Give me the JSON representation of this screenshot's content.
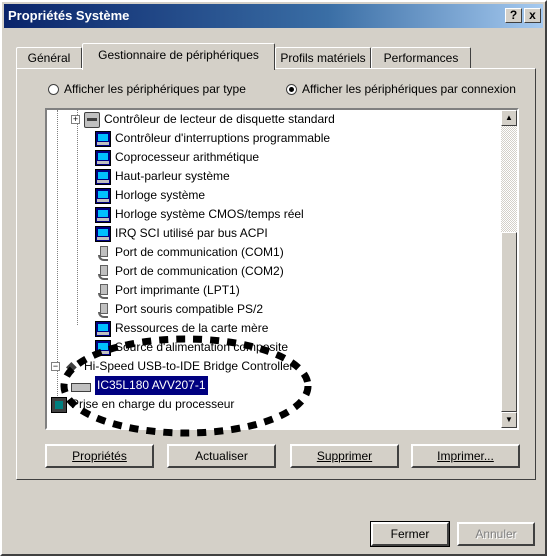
{
  "window": {
    "title": "Propriétés Système",
    "help_label": "?",
    "close_label": "x"
  },
  "tabs": [
    {
      "label": "Général"
    },
    {
      "label": "Gestionnaire de périphériques"
    },
    {
      "label": "Profils matériels"
    },
    {
      "label": "Performances"
    }
  ],
  "view": {
    "by_type_label": "Afficher les périphériques par type",
    "by_connection_label": "Afficher les périphériques par connexion",
    "selected": "by_connection"
  },
  "tree": {
    "items": [
      {
        "label": "Contrôleur de lecteur de disquette standard",
        "icon": "floppy-icon"
      },
      {
        "label": "Contrôleur d'interruptions programmable",
        "icon": "computer-icon"
      },
      {
        "label": "Coprocesseur arithmétique",
        "icon": "computer-icon"
      },
      {
        "label": "Haut-parleur système",
        "icon": "computer-icon"
      },
      {
        "label": "Horloge système",
        "icon": "computer-icon"
      },
      {
        "label": "Horloge système CMOS/temps réel",
        "icon": "computer-icon"
      },
      {
        "label": "IRQ SCI utilisé par bus ACPI",
        "icon": "computer-icon"
      },
      {
        "label": "Port de communication (COM1)",
        "icon": "port-icon"
      },
      {
        "label": "Port de communication (COM2)",
        "icon": "port-icon"
      },
      {
        "label": "Port imprimante (LPT1)",
        "icon": "port-icon"
      },
      {
        "label": "Port souris compatible PS/2",
        "icon": "port-icon"
      },
      {
        "label": "Ressources de la carte mère",
        "icon": "computer-icon"
      },
      {
        "label": "Source d'alimentation composite",
        "icon": "computer-icon"
      },
      {
        "label": "Hi-Speed USB-to-IDE Bridge Controller",
        "icon": "usb-icon"
      },
      {
        "label": "IC35L180 AVV207-1",
        "icon": "disk-icon"
      },
      {
        "label": "Prise en charge du processeur",
        "icon": "cpu-icon"
      }
    ],
    "selected_item": "IC35L180 AVV207-1"
  },
  "buttons": {
    "properties": "Propriétés",
    "refresh": "Actualiser",
    "remove": "Supprimer",
    "print": "Imprimer...",
    "close": "Fermer",
    "cancel": "Annuler"
  }
}
